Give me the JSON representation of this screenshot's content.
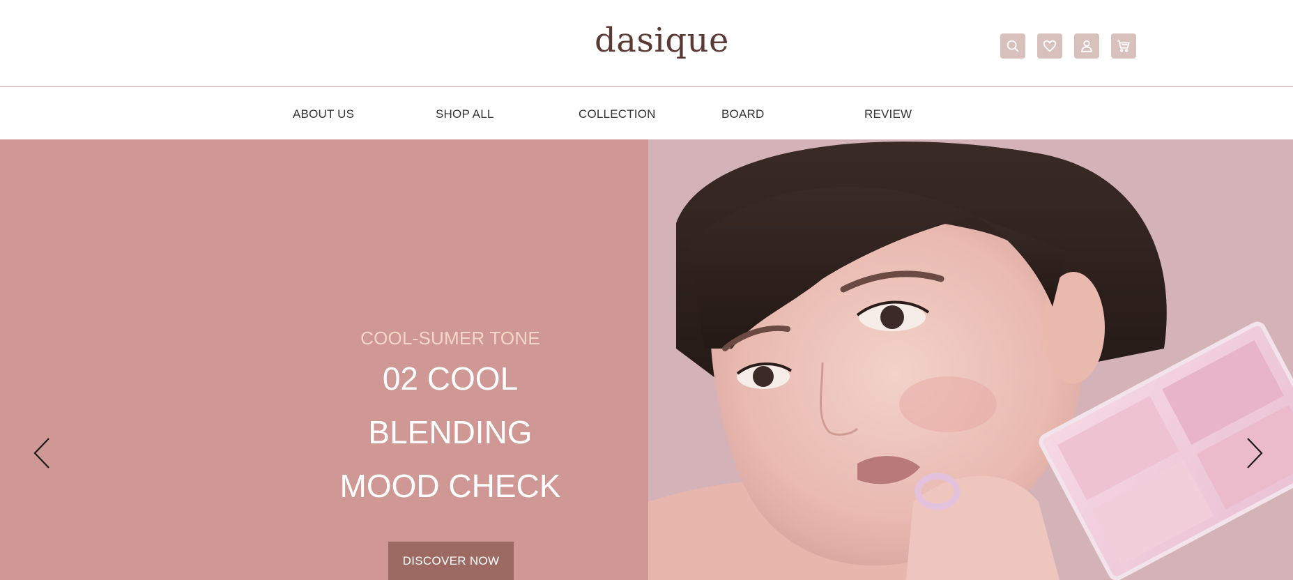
{
  "header": {
    "logo": "dasique",
    "icons": [
      {
        "name": "search-icon",
        "label": "search"
      },
      {
        "name": "heart-icon",
        "label": "wishlist"
      },
      {
        "name": "user-icon",
        "label": "account"
      },
      {
        "name": "cart-icon",
        "label": "cart"
      }
    ]
  },
  "nav": {
    "items": [
      {
        "label": "ABOUT US"
      },
      {
        "label": "SHOP ALL"
      },
      {
        "label": "COLLECTION"
      },
      {
        "label": "BOARD"
      },
      {
        "label": "REVIEW"
      }
    ]
  },
  "hero": {
    "eyebrow": "COOL-SUMER TONE",
    "headline_lines": [
      "02 COOL",
      "BLENDING",
      "MOOD CHECK"
    ],
    "cta_label": "DISCOVER NOW",
    "left_color": "#d09894",
    "cta_color": "#9c6a63",
    "eyebrow_color": "#f6d7c7",
    "image": "model-portrait-with-palette",
    "prev_icon": "chevron-left-icon",
    "next_icon": "chevron-right-icon"
  }
}
